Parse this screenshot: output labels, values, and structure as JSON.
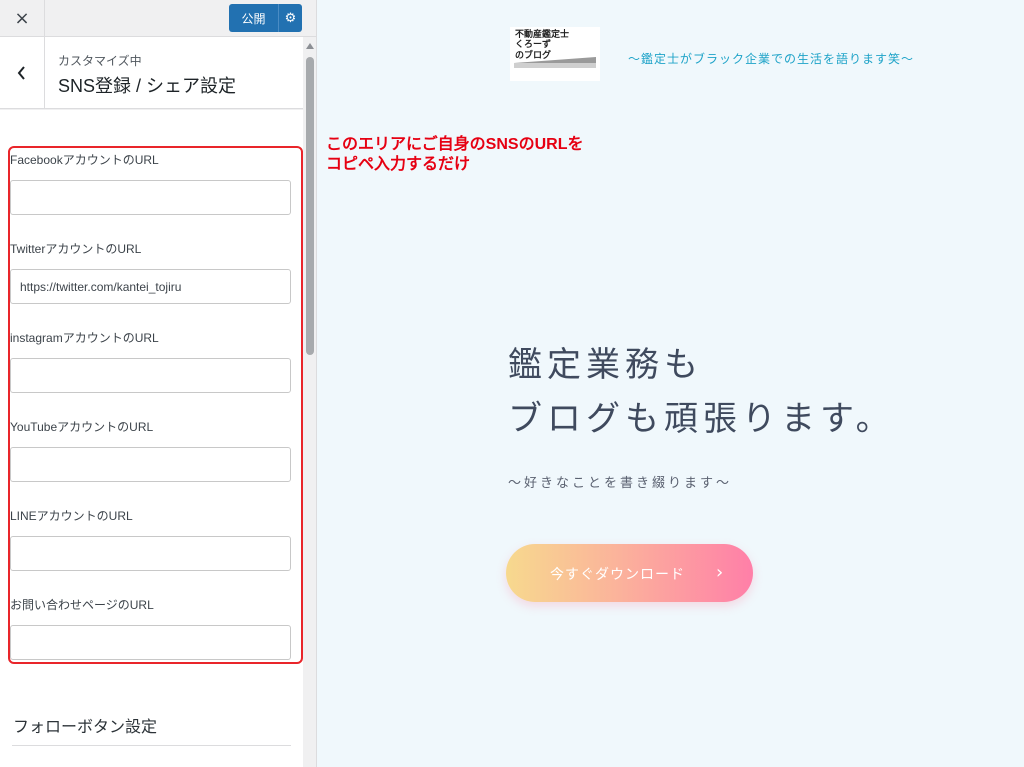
{
  "topbar": {
    "close_icon": "×",
    "publish_label": "公開",
    "publish_settings_icon": "⚙"
  },
  "section": {
    "breadcrumb": "カスタマイズ中",
    "title": "SNS登録 / シェア設定"
  },
  "fields": [
    {
      "label": "FacebookアカウントのURL",
      "value": "",
      "placeholder": ""
    },
    {
      "label": "TwitterアカウントのURL",
      "value": "https://twitter.com/kantei_tojiru",
      "placeholder": ""
    },
    {
      "label": "instagramアカウントのURL",
      "value": "",
      "placeholder": ""
    },
    {
      "label": "YouTubeアカウントのURL",
      "value": "",
      "placeholder": ""
    },
    {
      "label": "LINEアカウントのURL",
      "value": "",
      "placeholder": ""
    },
    {
      "label": "お問い合わせページのURL",
      "value": "",
      "placeholder": ""
    }
  ],
  "follow_section": {
    "label": "フォローボタン設定"
  },
  "annotation": {
    "line1": "このエリアにご自身のSNSのURLを",
    "line2": "コピペ入力するだけ",
    "color": "#e60012"
  },
  "preview": {
    "logo": {
      "line1": "不動産鑑定士",
      "line2": "くろーず",
      "line3": "のブログ"
    },
    "tagline": "～鑑定士がブラック企業での生活を語ります笑～",
    "hero_line1": "鑑定業務も",
    "hero_line2": "ブログも頑張ります。",
    "hero_sub": "～好きなことを書き綴ります～",
    "cta_label": "今すぐダウンロード",
    "cta_arrow": "›"
  },
  "colors": {
    "accent": "#2271b1",
    "preview_bg": "#f0f8fc",
    "tagline": "#1ea3c8",
    "cta_start": "#f7d98e",
    "cta_end": "#ff7fa8"
  }
}
